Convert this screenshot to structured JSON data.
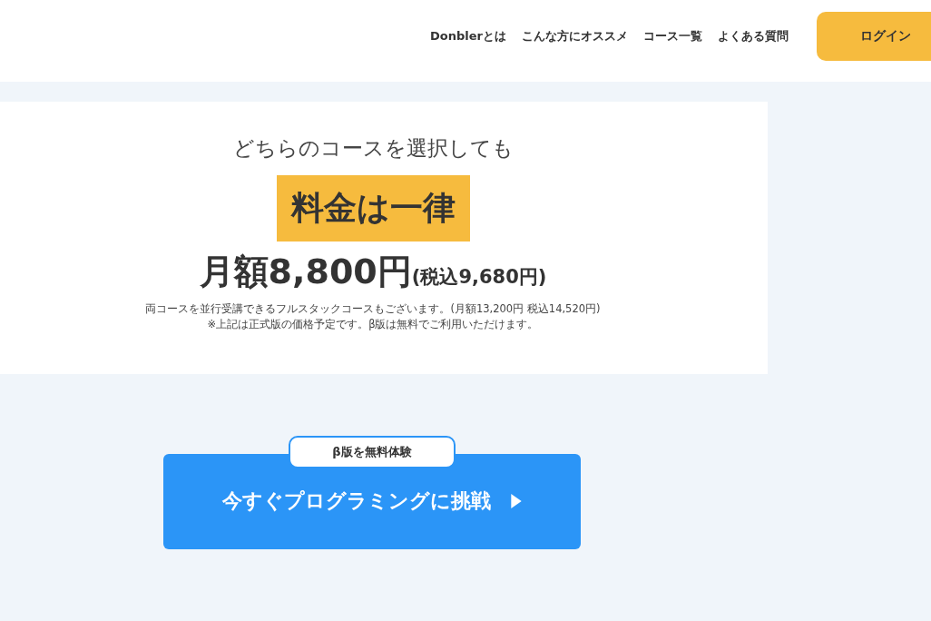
{
  "nav": {
    "links": [
      "Donblerとは",
      "こんな方にオススメ",
      "コース一覧",
      "よくある質問"
    ],
    "login": "ログイン"
  },
  "pricing": {
    "lead": "どちらのコースを選択しても",
    "headline": "料金は一律",
    "price": "月額8,800円",
    "price_tax": "(税込9,680円)",
    "notes": [
      "両コースを並行受講できるフルスタックコースもございます。(月額13,200円 税込14,520円)",
      "※上記は正式版の価格予定です。β版は無料でご利用いただけます。"
    ]
  },
  "cta": {
    "badge": "β版を無料体験",
    "label": "今すぐプログラミングに挑戦"
  }
}
